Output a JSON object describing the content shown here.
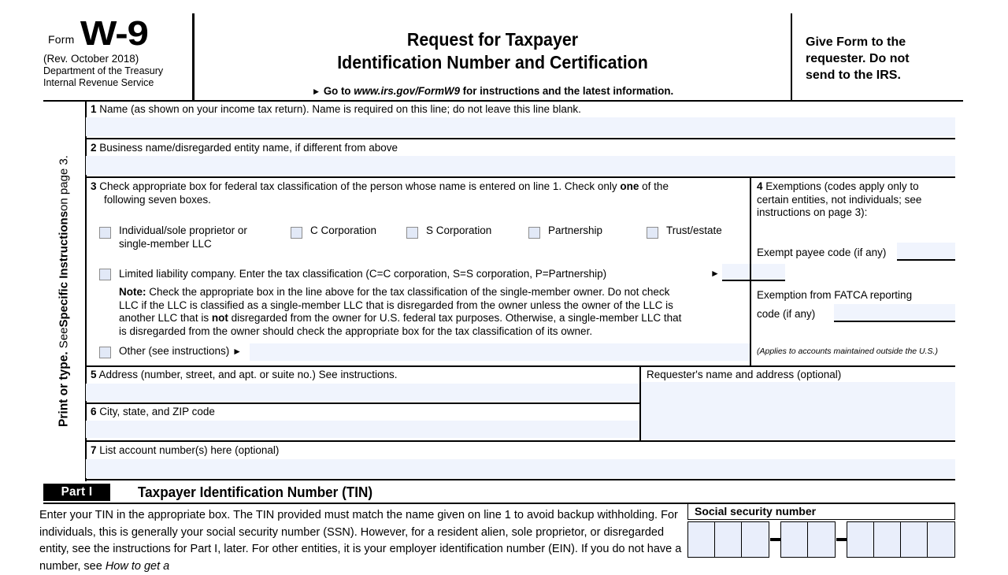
{
  "header": {
    "form_label": "Form",
    "form_number": "W-9",
    "revision": "(Rev. October 2018)",
    "dept_line1": "Department of the Treasury",
    "dept_line2": "Internal Revenue Service",
    "title_line1": "Request for Taxpayer",
    "title_line2": "Identification Number and Certification",
    "goto_prefix": "Go to",
    "goto_url": "www.irs.gov/FormW9",
    "goto_suffix": "for instructions and the latest information.",
    "give_line1": "Give Form to the",
    "give_line2": "requester. Do not",
    "give_line3": "send to the IRS."
  },
  "sidebar": {
    "text_bold1": "Print or type.",
    "text_normal1": "See ",
    "text_bold2": "Specific Instructions",
    "text_normal2": " on page 3."
  },
  "line1": {
    "num": "1",
    "label": "Name (as shown on your income tax return). Name is required on this line; do not leave this line blank.",
    "value": ""
  },
  "line2": {
    "num": "2",
    "label": "Business name/disregarded entity name, if different from above",
    "value": ""
  },
  "line3": {
    "num": "3",
    "instruction_part1": "Check appropriate box for federal tax classification of the person whose name is entered on line 1. Check only ",
    "instruction_bold": "one",
    "instruction_part2": " of the",
    "instruction_line2": "following seven boxes.",
    "checkboxes": [
      {
        "id": "individual",
        "label_line1": "Individual/sole proprietor or",
        "label_line2": "single-member LLC"
      },
      {
        "id": "c-corp",
        "label_line1": "C Corporation",
        "label_line2": ""
      },
      {
        "id": "s-corp",
        "label_line1": "S Corporation",
        "label_line2": ""
      },
      {
        "id": "partnership",
        "label_line1": "Partnership",
        "label_line2": ""
      },
      {
        "id": "trust-estate",
        "label_line1": "Trust/estate",
        "label_line2": ""
      }
    ],
    "llc": {
      "label": "Limited liability company. Enter the tax classification (C=C corporation, S=S corporation, P=Partnership)",
      "value": ""
    },
    "note_bold": "Note:",
    "note_line1": " Check the appropriate box in the line above for the tax classification of the single-member owner.  Do not check",
    "note_line2": "LLC if the LLC is classified as a single-member LLC that is disregarded from the owner unless the owner of the LLC is",
    "note_line3a": "another LLC that is ",
    "note_line3b": "not",
    "note_line3c": " disregarded from the owner for U.S. federal tax purposes. Otherwise, a single-member LLC that",
    "note_line4": "is disregarded from the owner should check the appropriate box for the tax classification of its owner.",
    "other": {
      "label": "Other (see instructions)",
      "value": ""
    }
  },
  "line4": {
    "num": "4",
    "title_line1": "Exemptions (codes apply only to",
    "title_line2": "certain entities, not individuals; see",
    "title_line3": "instructions on page 3):",
    "exempt_payee_label": "Exempt payee code (if any)",
    "exempt_payee_value": "",
    "fatca_label_line1": "Exemption from FATCA reporting",
    "fatca_label_line2": "code (if any)",
    "fatca_value": "",
    "footnote": "(Applies to accounts maintained outside the U.S.)"
  },
  "line5": {
    "num": "5",
    "label": "Address (number, street, and apt. or suite no.) See instructions.",
    "value": ""
  },
  "line6": {
    "num": "6",
    "label": "City, state, and ZIP code",
    "value": ""
  },
  "line7": {
    "num": "7",
    "label": "List account number(s) here (optional)",
    "value": ""
  },
  "requester": {
    "label": "Requester's name and address (optional)",
    "value": ""
  },
  "part1": {
    "badge": "Part I",
    "title": "Taxpayer Identification Number (TIN)",
    "paragraph_a": "Enter your TIN in the appropriate box. The TIN provided must match the name given on line 1 to avoid backup withholding. For individuals, this is generally your social security number (SSN). However, for a resident alien, sole proprietor, or disregarded entity, see the instructions for Part I, later. For other entities, it is your employer identification number (EIN). If you do not have a number, see ",
    "paragraph_italic": "How to get a",
    "ssn_label": "Social security number",
    "ssn_groups": [
      3,
      2,
      4
    ],
    "ssn_separator": "–"
  },
  "colors": {
    "field_fill": "#f0f4fd",
    "checkbox_fill": "#e2e9f7",
    "rule": "#000000"
  }
}
